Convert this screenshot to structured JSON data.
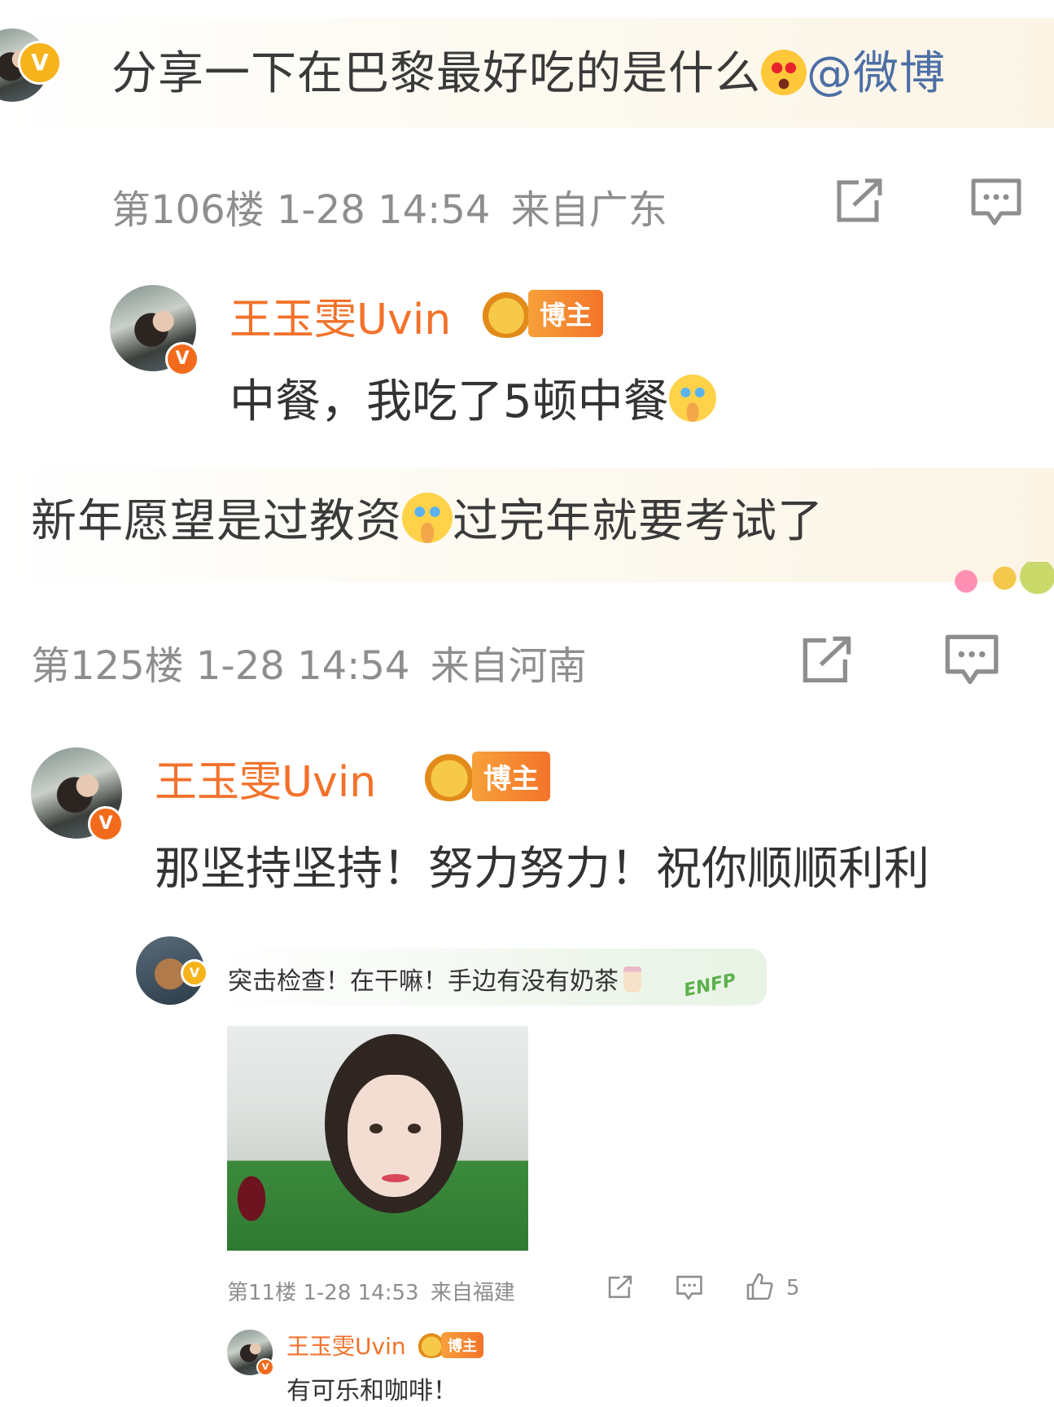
{
  "top_comment": {
    "text": "分享一下在巴黎最好吃的是什么",
    "mention": "@微博",
    "emoji": "heart-eyes-emoji"
  },
  "floor1": {
    "floor": "第106楼",
    "time": "1-28 14:54",
    "location": "来自广东",
    "reply": {
      "author": "王玉雯Uvin",
      "badge": "博主",
      "text": "中餐，我吃了5顿中餐",
      "emoji": "crying-emoji"
    }
  },
  "comment2": {
    "text_before": "新年愿望是过教资",
    "text_after": "过完年就要考试了",
    "emoji": "crying-emoji"
  },
  "floor2": {
    "floor": "第125楼",
    "time": "1-28 14:54",
    "location": "来自河南",
    "reply": {
      "author": "王玉雯Uvin",
      "badge": "博主",
      "text": "那坚持坚持！努力努力！祝你顺顺利利"
    }
  },
  "comment3": {
    "text": "突击检查！在干嘛！手边有没有奶茶",
    "sticker": "ENFP",
    "floor": "第11楼",
    "time": "1-28 14:53",
    "location": "来自福建",
    "likes": "5",
    "reply": {
      "author": "王玉雯Uvin",
      "badge": "博主",
      "text": "有可乐和咖啡！"
    }
  },
  "colors": {
    "name": "#f2722b",
    "meta": "#8e8e8e",
    "text": "#333333",
    "badge_bg": "#f3742a",
    "verified": "#f6b31b"
  }
}
